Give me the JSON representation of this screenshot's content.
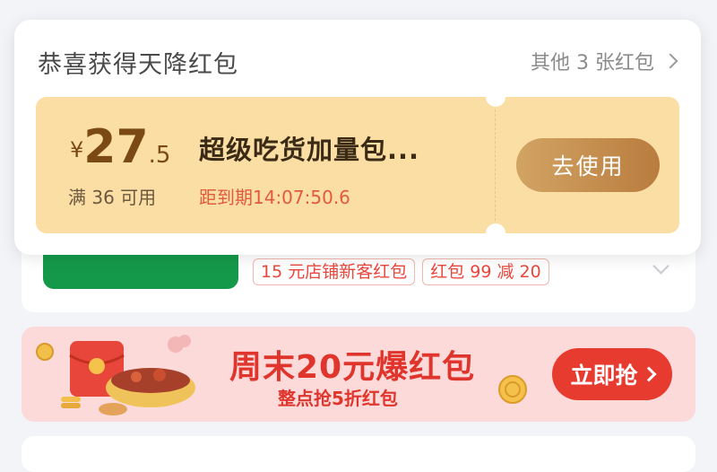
{
  "popup": {
    "title": "恭喜获得天降红包",
    "other_link": "其他 3 张红包"
  },
  "coupon": {
    "currency": "¥",
    "amount_int": "27",
    "amount_dec": ".5",
    "condition": "满 36 可用",
    "name": "超级吃货加量包...",
    "expire": "距到期14:07:50.6",
    "use_label": "去使用"
  },
  "store": {
    "tags": [
      "15 元店铺新客红包",
      "红包 99 减 20"
    ]
  },
  "promo": {
    "title": "周末20元爆红包",
    "subtitle": "整点抢5折红包",
    "button_label": "立即抢"
  },
  "colors": {
    "popup_bg": "#ffffff",
    "coupon_bg": "#fbdea4",
    "use_button": "#c18a4c",
    "promo_bg": "#fcdada",
    "promo_accent": "#e0352c",
    "store_green": "#14994a"
  }
}
